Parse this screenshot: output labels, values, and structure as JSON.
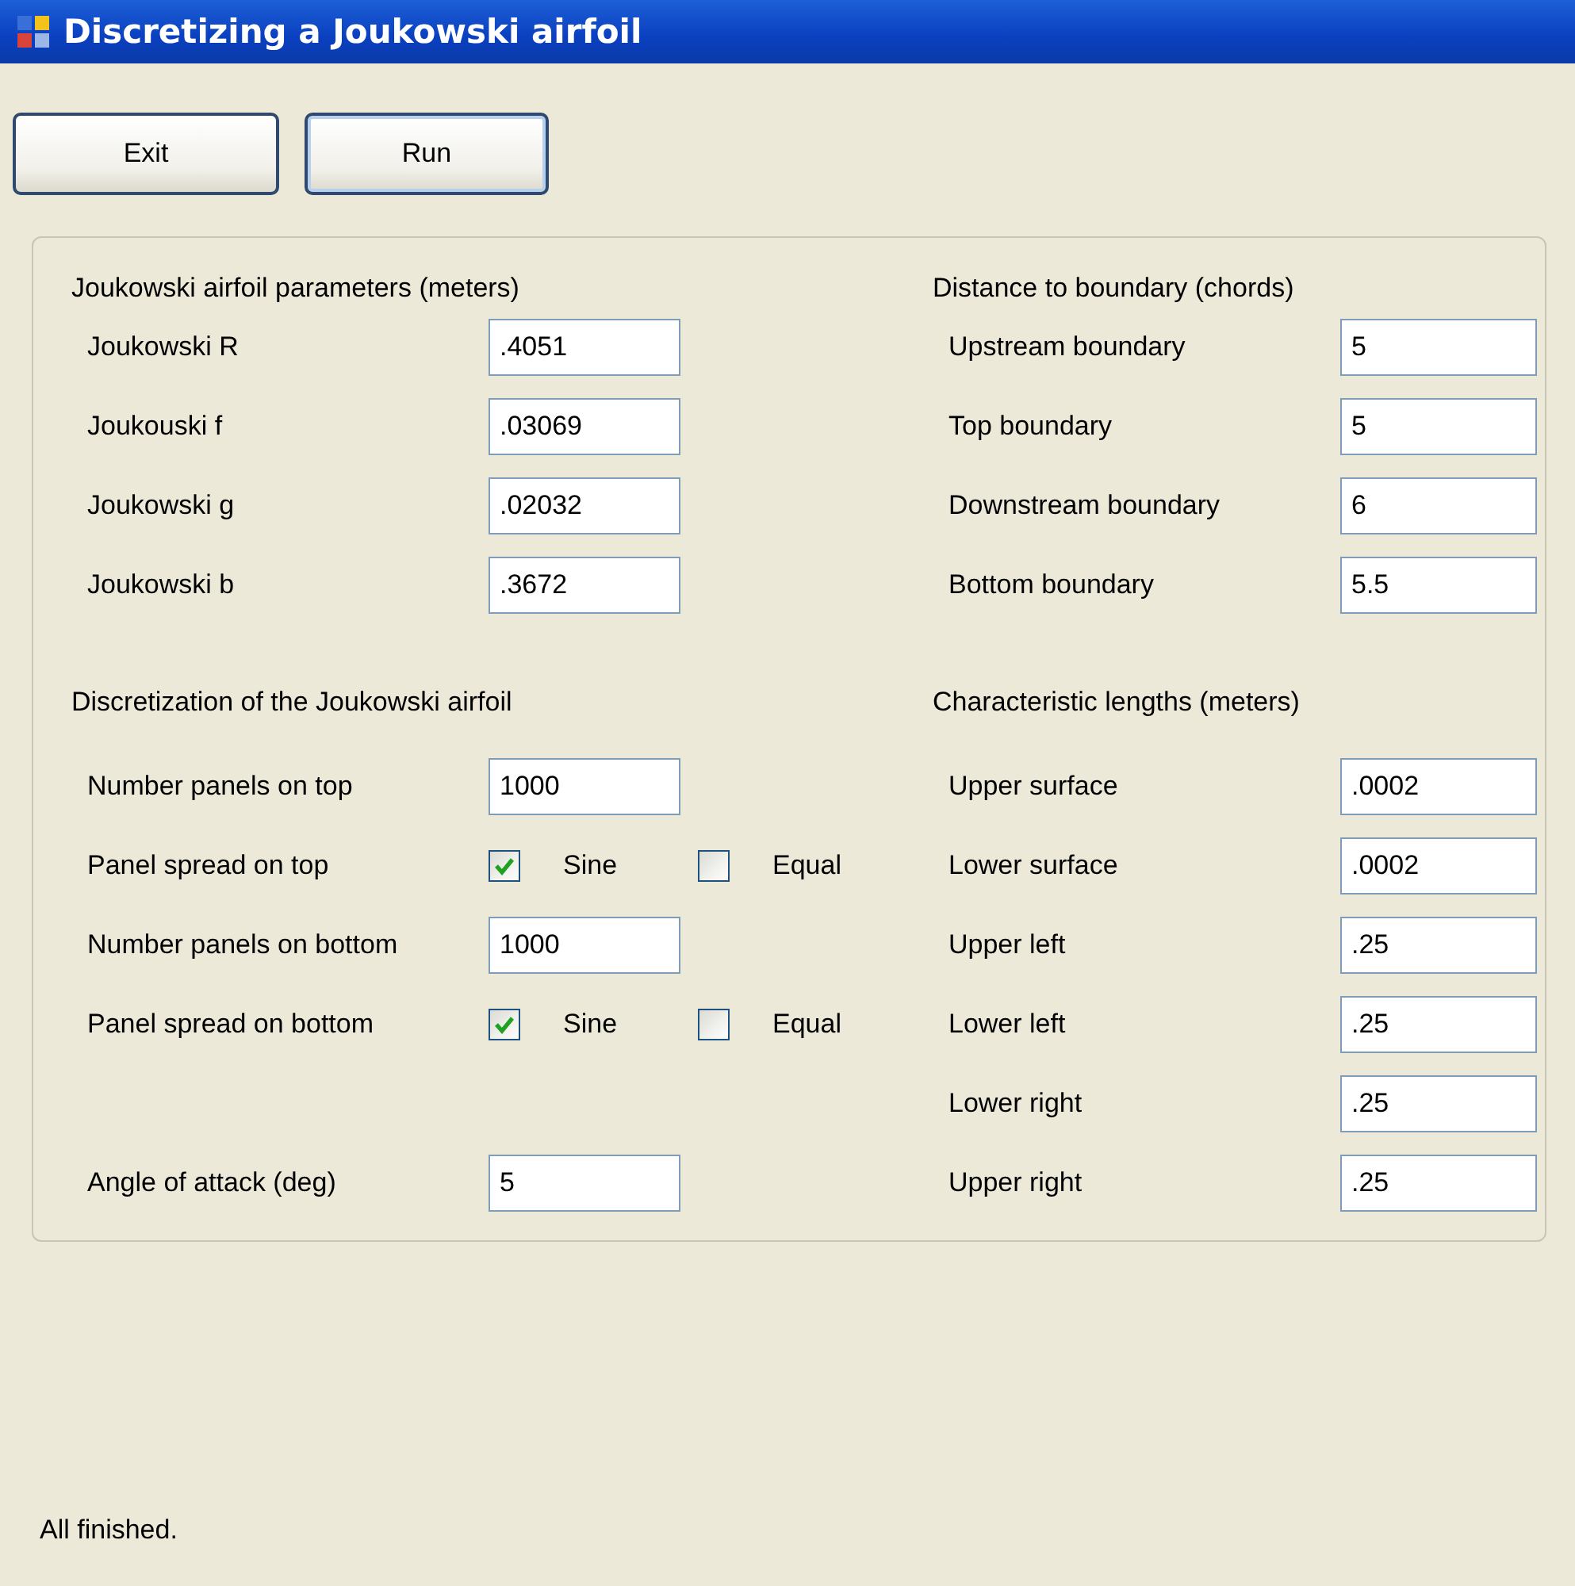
{
  "window": {
    "title": "Discretizing a Joukowski airfoil"
  },
  "buttons": [
    "Exit",
    "Run"
  ],
  "left": [
    {
      "heading": "Joukowski airfoil parameters (meters)",
      "rows": [
        {
          "kind": "field",
          "label": "Joukowski R",
          "value": ".4051"
        },
        {
          "kind": "field",
          "label": "Joukouski f",
          "value": ".03069"
        },
        {
          "kind": "field",
          "label": "Joukowski g",
          "value": ".02032"
        },
        {
          "kind": "field",
          "label": "Joukowski b",
          "value": ".3672"
        }
      ]
    },
    {
      "heading": "Discretization of the Joukowski airfoil",
      "rows": [
        {
          "kind": "field",
          "label": "Number panels on top",
          "value": "1000"
        },
        {
          "kind": "choice",
          "label": "Panel spread on top",
          "options": [
            {
              "label": "Sine",
              "checked": true
            },
            {
              "label": "Equal",
              "checked": false
            }
          ]
        },
        {
          "kind": "field",
          "label": "Number panels on bottom",
          "value": "1000"
        },
        {
          "kind": "choice",
          "label": "Panel spread on bottom",
          "options": [
            {
              "label": "Sine",
              "checked": true
            },
            {
              "label": "Equal",
              "checked": false
            }
          ]
        }
      ]
    }
  ],
  "angle": {
    "label": "Angle of attack (deg)",
    "value": "5"
  },
  "right": [
    {
      "heading": "Distance to boundary (chords)",
      "rows": [
        {
          "kind": "field",
          "label": "Upstream boundary",
          "value": "5"
        },
        {
          "kind": "field",
          "label": "Top boundary",
          "value": "5"
        },
        {
          "kind": "field",
          "label": "Downstream boundary",
          "value": "6"
        },
        {
          "kind": "field",
          "label": "Bottom boundary",
          "value": "5.5"
        }
      ]
    },
    {
      "heading": "Characteristic lengths (meters)",
      "rows": [
        {
          "kind": "field",
          "label": "Upper surface",
          "value": ".0002"
        },
        {
          "kind": "field",
          "label": "Lower surface",
          "value": ".0002"
        },
        {
          "kind": "field",
          "label": "Upper left",
          "value": ".25"
        },
        {
          "kind": "field",
          "label": "Lower left",
          "value": ".25"
        },
        {
          "kind": "field",
          "label": "Lower right",
          "value": ".25"
        },
        {
          "kind": "field",
          "label": "Upper right",
          "value": ".25"
        }
      ]
    }
  ],
  "status_bar": "All finished."
}
